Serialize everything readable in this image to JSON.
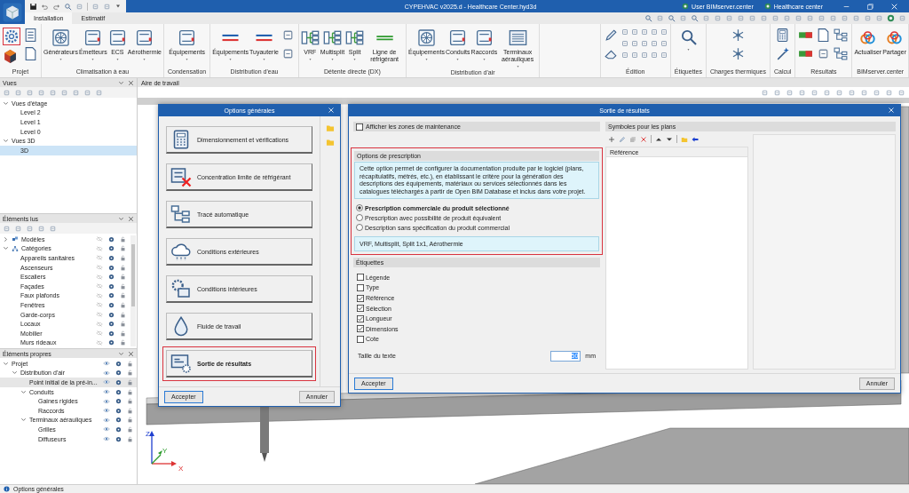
{
  "window": {
    "title": "CYPEHVAC v2025.d - Healthcare Center.hyd3d",
    "user": "User BIMserver.center",
    "project": "Healthcare center"
  },
  "tabs": [
    {
      "label": "Installation",
      "selected": true
    },
    {
      "label": "Estimatif",
      "selected": false
    }
  ],
  "ribbon": {
    "groups": [
      {
        "label": "Projet",
        "buttons": [
          {
            "kind": "stack",
            "highlighted": true
          },
          {
            "kind": "stack",
            "highlighted": false
          }
        ]
      },
      {
        "label": "Climatisation à eau",
        "buttons": [
          {
            "kind": "large",
            "label": "Générateurs",
            "dropdown": true
          },
          {
            "kind": "large",
            "label": "Émetteurs",
            "dropdown": true
          },
          {
            "kind": "large",
            "label": "ECS",
            "dropdown": true
          },
          {
            "kind": "large",
            "label": "Aérothermie",
            "dropdown": true
          }
        ]
      },
      {
        "label": "Condensation",
        "buttons": [
          {
            "kind": "large",
            "label": "Équipements",
            "dropdown": true
          }
        ]
      },
      {
        "label": "Distribution d'eau",
        "buttons": [
          {
            "kind": "large",
            "label": "Équipements",
            "dropdown": true
          },
          {
            "kind": "large",
            "label": "Tuyauterie",
            "dropdown": true
          },
          {
            "kind": "stack",
            "highlighted": false
          }
        ]
      },
      {
        "label": "Détente directe (DX)",
        "buttons": [
          {
            "kind": "large",
            "label": "VRF",
            "dropdown": true
          },
          {
            "kind": "large",
            "label": "Multisplit",
            "dropdown": true
          },
          {
            "kind": "large",
            "label": "Split",
            "dropdown": true
          },
          {
            "kind": "large",
            "label": "Ligne de réfrigérant",
            "dropdown": false
          }
        ]
      },
      {
        "label": "Distribution d'air",
        "buttons": [
          {
            "kind": "large",
            "label": "Équipements",
            "dropdown": true
          },
          {
            "kind": "large",
            "label": "Conduits",
            "dropdown": true
          },
          {
            "kind": "large",
            "label": "Raccords",
            "dropdown": true
          },
          {
            "kind": "large",
            "label": "Terminaux aérauliques",
            "dropdown": true
          }
        ]
      },
      {
        "kind": "spacer"
      },
      {
        "label": "Édition",
        "buttons": [
          {
            "kind": "stack",
            "highlighted": false
          },
          {
            "kind": "column"
          },
          {
            "kind": "column"
          },
          {
            "kind": "column"
          },
          {
            "kind": "column"
          },
          {
            "kind": "column"
          }
        ]
      },
      {
        "label": "Étiquettes",
        "buttons": [
          {
            "kind": "icon",
            "dropdown": true
          }
        ]
      },
      {
        "label": "Charges thermiques",
        "buttons": [
          {
            "kind": "stack",
            "highlighted": false
          }
        ]
      },
      {
        "label": "Calcul",
        "buttons": [
          {
            "kind": "stack",
            "highlighted": false
          }
        ]
      },
      {
        "label": "Résultats",
        "buttons": [
          {
            "kind": "stack",
            "highlighted": false
          },
          {
            "kind": "stack",
            "highlighted": false
          },
          {
            "kind": "stack",
            "highlighted": false
          }
        ]
      },
      {
        "label": "BIMserver.center",
        "buttons": [
          {
            "kind": "large",
            "label": "Actualiser",
            "dropdown": false
          },
          {
            "kind": "large",
            "label": "Partager",
            "dropdown": false
          }
        ]
      }
    ]
  },
  "views_panel": {
    "title": "Vues",
    "tree": [
      {
        "label": "Vues d'étage",
        "expanded": true,
        "selected": false,
        "children": [
          {
            "label": "Level 2",
            "selected": false
          },
          {
            "label": "Level 1",
            "selected": false
          },
          {
            "label": "Level 0",
            "selected": false
          }
        ]
      },
      {
        "label": "Vues 3D",
        "expanded": true,
        "selected": false,
        "children": [
          {
            "label": "3D",
            "selected": true
          }
        ]
      }
    ]
  },
  "read_elements": {
    "title": "Éléments lus",
    "tree": [
      {
        "label": "Modèles",
        "expanded": false,
        "visible": false
      },
      {
        "label": "Catégories",
        "expanded": true,
        "visible": false,
        "children": [
          {
            "label": "Appareils sanitaires",
            "visible": false
          },
          {
            "label": "Ascenseurs",
            "visible": false
          },
          {
            "label": "Escaliers",
            "visible": false
          },
          {
            "label": "Façades",
            "visible": false
          },
          {
            "label": "Faux plafonds",
            "visible": false
          },
          {
            "label": "Fenêtres",
            "visible": false
          },
          {
            "label": "Garde-corps",
            "visible": false
          },
          {
            "label": "Locaux",
            "visible": false
          },
          {
            "label": "Mobilier",
            "visible": false
          },
          {
            "label": "Murs rideaux",
            "visible": false
          }
        ]
      }
    ]
  },
  "own_elements": {
    "title": "Éléments propres",
    "tree": [
      {
        "label": "Projet",
        "expanded": true,
        "visible": true,
        "selected": false,
        "children": [
          {
            "label": "Distribution d'air",
            "expanded": true,
            "visible": true,
            "selected": false,
            "children": [
              {
                "label": "Point initial de la pré-in...",
                "visible": true,
                "selected": true
              },
              {
                "label": "Conduits",
                "expanded": true,
                "visible": true,
                "selected": false,
                "children": [
                  {
                    "label": "Gaines rigides",
                    "visible": true,
                    "selected": false
                  },
                  {
                    "label": "Raccords",
                    "visible": true,
                    "selected": false
                  }
                ]
              },
              {
                "label": "Terminaux aérauliques",
                "expanded": true,
                "visible": true,
                "selected": false,
                "children": [
                  {
                    "label": "Grilles",
                    "visible": true,
                    "selected": false
                  },
                  {
                    "label": "Diffuseurs",
                    "visible": true,
                    "selected": false
                  }
                ]
              }
            ]
          }
        ]
      }
    ]
  },
  "workspace": {
    "title": "Aire de travail",
    "axes": [
      "X",
      "Y",
      "Z"
    ]
  },
  "options_dialog": {
    "title": "Options générales",
    "items": [
      {
        "label": "Dimensionnement et vérifications",
        "highlighted": false
      },
      {
        "label": "Concentration limite de réfrigérant",
        "highlighted": false
      },
      {
        "label": "Tracé automatique",
        "highlighted": false
      },
      {
        "label": "Conditions extérieures",
        "highlighted": false
      },
      {
        "label": "Conditions intérieures",
        "highlighted": false
      },
      {
        "label": "Fluide de travail",
        "highlighted": false
      },
      {
        "label": "Sortie de résultats",
        "highlighted": true
      }
    ],
    "buttons": [
      "Accepter",
      "Annuler"
    ]
  },
  "results_dialog": {
    "title": "Sortie de résultats",
    "maintenance": {
      "label": "Afficher les zones de maintenance",
      "checked": false
    },
    "prescription": {
      "title": "Options de prescription",
      "highlighted": true,
      "info": "Cette option permet de configurer la documentation produite par le logiciel (plans, récapitulatifs, métrés, etc.), en établissant le critère pour la génération des descriptions des équipements, matériaux ou services sélectionnés dans les catalogues téléchargés à partir de Open BIM Database et inclus dans votre projet.",
      "options": [
        {
          "label": "Prescription commerciale du produit sélectionné",
          "selected": true
        },
        {
          "label": "Prescription avec possibilité de produit équivalent",
          "selected": false
        },
        {
          "label": "Description sans spécification du produit commercial",
          "selected": false
        }
      ],
      "scope": "VRF, Multisplit, Split 1x1, Aérothermie"
    },
    "labels": {
      "title": "Étiquettes",
      "items": [
        {
          "label": "Légende",
          "checked": false
        },
        {
          "label": "Type",
          "checked": false
        },
        {
          "label": "Référence",
          "checked": true
        },
        {
          "label": "Sélection",
          "checked": true
        },
        {
          "label": "Longueur",
          "checked": true
        },
        {
          "label": "Dimensions",
          "checked": true
        },
        {
          "label": "Cote",
          "checked": false
        }
      ],
      "text_size": {
        "label": "Taille du texte",
        "value": "50",
        "unit": "mm"
      }
    },
    "symbols": {
      "title": "Symboles pour les plans",
      "columns": [
        "Référence"
      ]
    },
    "buttons": [
      "Accepter",
      "Annuler"
    ]
  },
  "status_bar": {
    "text": "Options générales"
  }
}
